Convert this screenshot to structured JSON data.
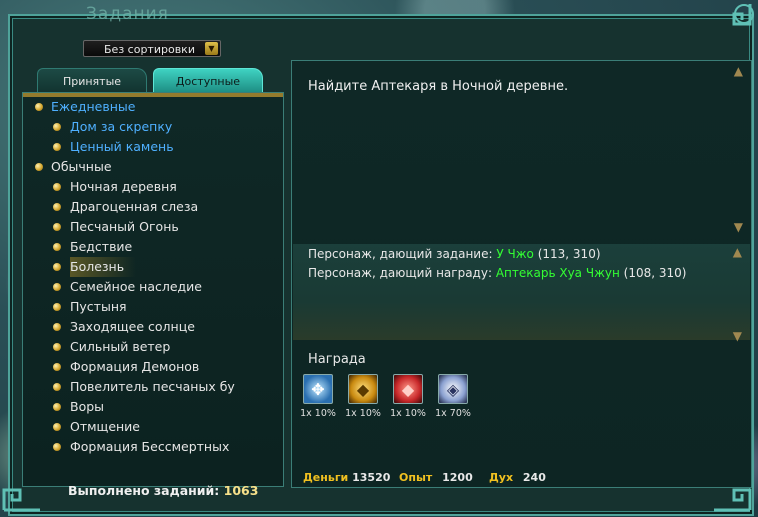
{
  "window": {
    "title": "Задания"
  },
  "sort": {
    "selected": "Без сортировки"
  },
  "tabs": [
    {
      "label": "Принятые"
    },
    {
      "label": "Доступные"
    }
  ],
  "quests": {
    "daily_label": "Ежедневные",
    "daily": [
      "Дом за скрепку",
      "Ценный камень"
    ],
    "normal_label": "Обычные",
    "normal": [
      "Ночная деревня",
      "Драгоценная слеза",
      "Песчаный Огонь",
      "Бедствие",
      "Болезнь",
      "Семейное наследие",
      "Пустыня",
      "Заходящее солнце",
      "Сильный ветер",
      "Формация Демонов",
      "Повелитель песчаных бу",
      "Воры",
      "Отмщение",
      "Формация Бессмертных"
    ],
    "selected": "Болезнь"
  },
  "detail": {
    "description": "Найдите Аптекаря в Ночной деревне.",
    "giver_label": "Персонаж, дающий задание:",
    "giver_name": "У Чжо",
    "giver_coords": "(113, 310)",
    "receiver_label": "Персонаж, дающий награду:",
    "receiver_name": "Аптекарь Хуа Чжун",
    "receiver_coords": "(108, 310)"
  },
  "rewards": {
    "title": "Награда",
    "items": [
      {
        "icon": "crystal-cross-icon",
        "label": "1x 10%",
        "color": "#2a6fb0"
      },
      {
        "icon": "gold-ore-icon",
        "label": "1x 10%",
        "color": "#c98a10"
      },
      {
        "icon": "red-gem-icon",
        "label": "1x 10%",
        "color": "#c8282a"
      },
      {
        "icon": "silver-crystal-icon",
        "label": "1x 70%",
        "color": "#8aa0d0"
      }
    ]
  },
  "stats": {
    "money_label": "Деньги",
    "money": "13520",
    "exp_label": "Опыт",
    "exp": "1200",
    "spirit_label": "Дух",
    "spirit": "240"
  },
  "footer": {
    "completed_label": "Выполнено заданий:",
    "completed_value": "1063"
  },
  "colors": {
    "accent": "#4fa39a",
    "gold": "#f0c020",
    "npc_green": "#33ff33",
    "category_blue": "#4fb0ff"
  }
}
